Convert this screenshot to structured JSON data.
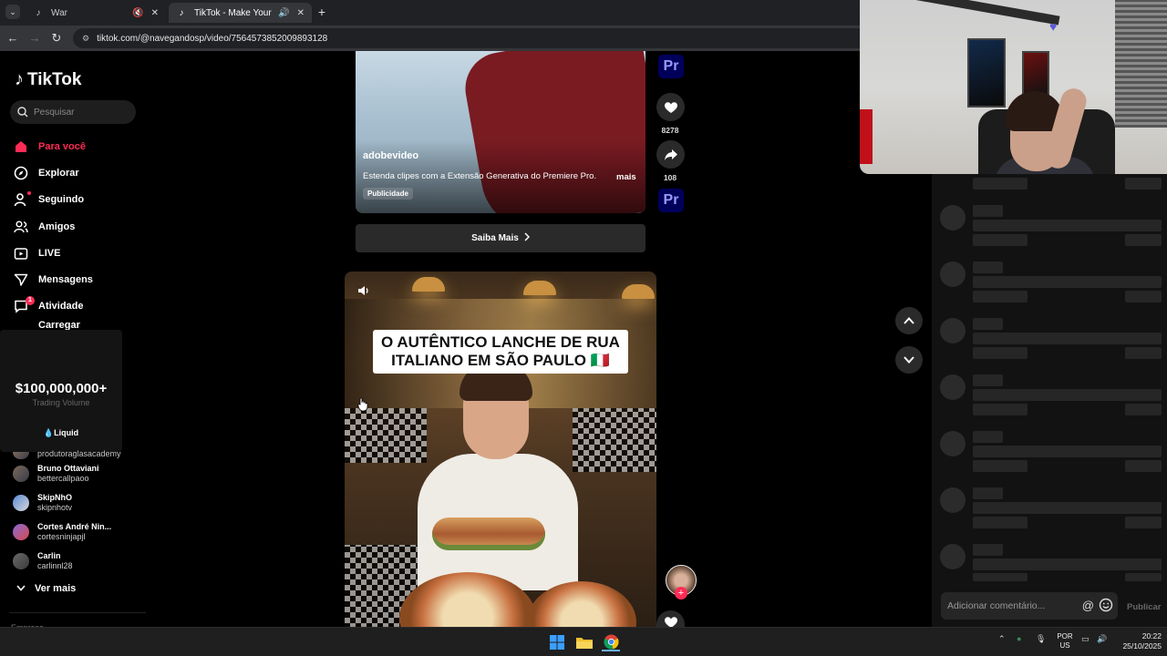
{
  "browser": {
    "tabs": [
      {
        "title": "War",
        "active": false
      },
      {
        "title": "TikTok - Make Your Day",
        "active": true
      }
    ],
    "new_tab_symbol": "+",
    "url": "tiktok.com/@navegandosp/video/7564573852009893128"
  },
  "sidebar": {
    "logo_text": "TikTok",
    "search_placeholder": "Pesquisar",
    "menu": [
      {
        "label": "Para você",
        "icon": "home-icon",
        "active": true
      },
      {
        "label": "Explorar",
        "icon": "compass-icon"
      },
      {
        "label": "Seguindo",
        "icon": "following-icon"
      },
      {
        "label": "Amigos",
        "icon": "friends-icon"
      },
      {
        "label": "LIVE",
        "icon": "live-icon"
      },
      {
        "label": "Mensagens",
        "icon": "messages-icon"
      },
      {
        "label": "Atividade",
        "icon": "activity-icon",
        "badge": "1"
      },
      {
        "label": "Carregar",
        "icon": "upload-icon"
      }
    ],
    "ad": {
      "amount": "$100,000,000+",
      "subtitle": "Trading Volume",
      "brand": "Liquid"
    },
    "following": [
      {
        "name": "",
        "handle": "produtoraglasacademy"
      },
      {
        "name": "Bruno Ottaviani",
        "handle": "bettercallpaoo"
      },
      {
        "name": "SkipNhO",
        "handle": "skipnhotv"
      },
      {
        "name": "Cortes André Nin...",
        "handle": "cortesninjapjl"
      },
      {
        "name": "Carlin",
        "handle": "carlinnl28"
      }
    ],
    "ver_mais": "Ver mais",
    "empresa": "Empresa"
  },
  "video_ad": {
    "username": "adobevideo",
    "description": "Estenda clipes com a Extensão Generativa do Premiere Pro.",
    "more": "mais",
    "tag": "Publicidade",
    "cta": "Saiba Mais",
    "likes": "8278",
    "shares": "108",
    "brand_badge": "Pr"
  },
  "video_main": {
    "caption_line1": "O AUTÊNTICO LANCHE DE RUA",
    "caption_line2": "ITALIANO EM SÃO PAULO 🇮🇹"
  },
  "comments": {
    "placeholder": "Adicionar comentário...",
    "post_label": "Publicar"
  },
  "taskbar": {
    "lang_line1": "POR",
    "lang_line2": "US",
    "time": "20:22",
    "date": "25/10/2025"
  },
  "colors": {
    "accent": "#fe2c55",
    "background": "#000000"
  }
}
